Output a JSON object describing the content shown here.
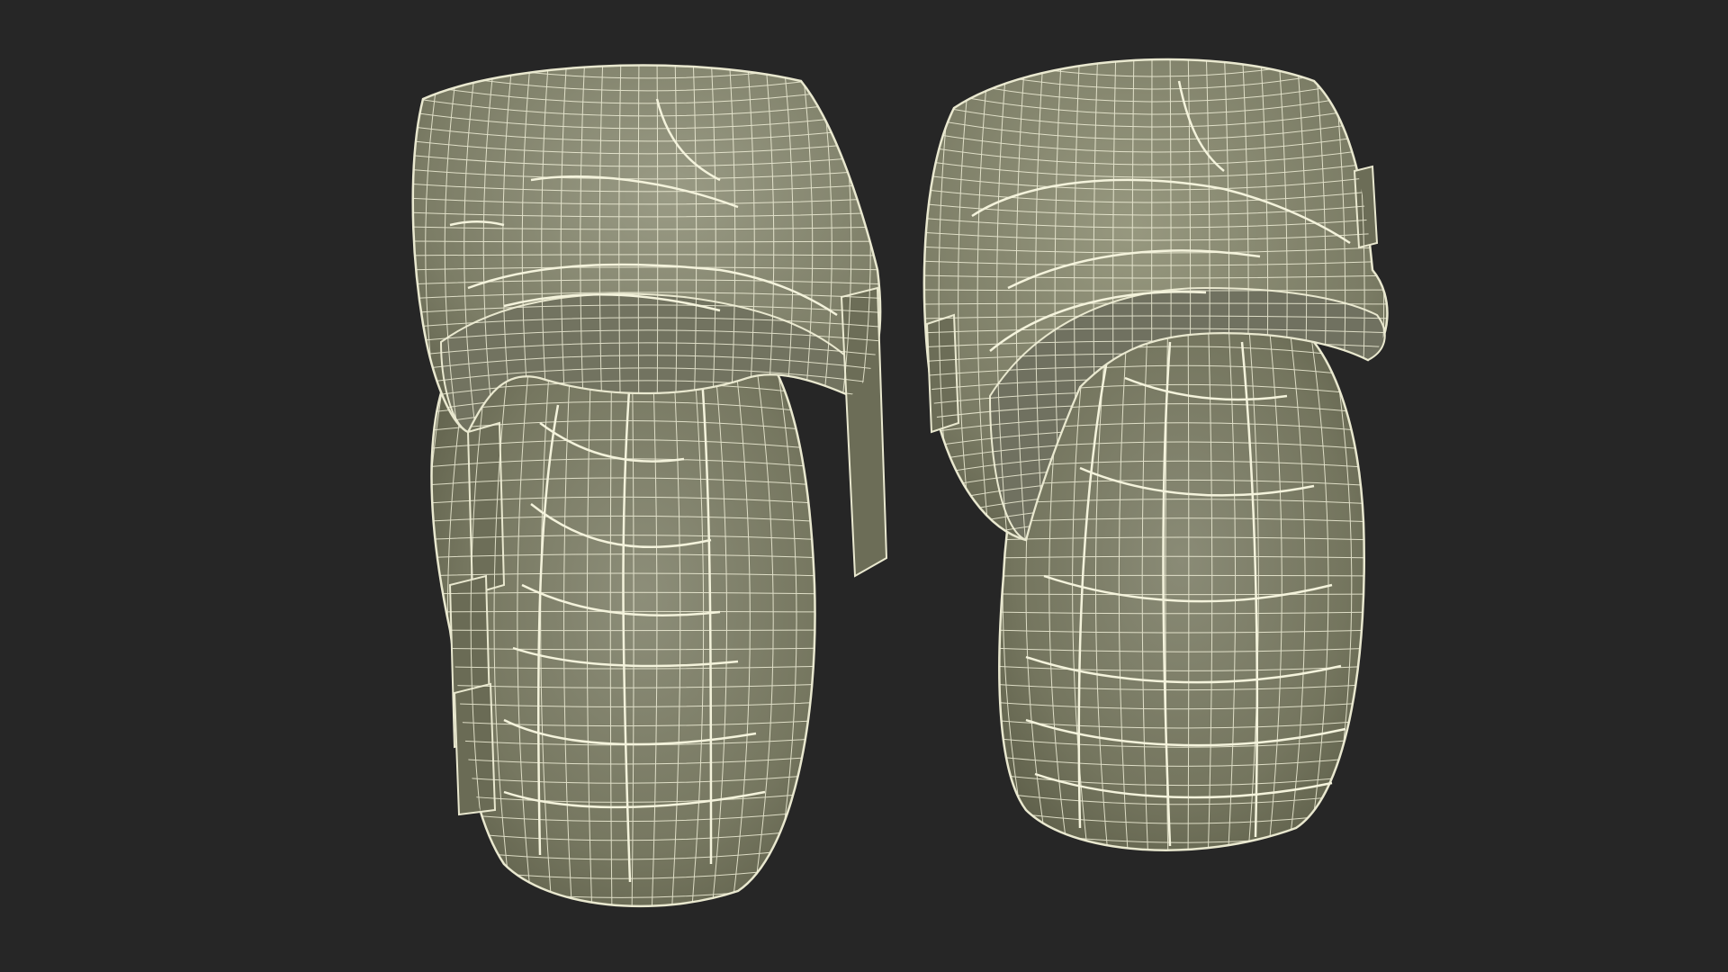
{
  "scene": {
    "subject": "pair-of-knee-pads-wireframe",
    "colors": {
      "background": "#262626",
      "surface_light": "#8a8b76",
      "surface_mid": "#76775f",
      "surface_dark": "#5d5e49",
      "wire": "#f1f0d9"
    },
    "objects": [
      {
        "name": "left-knee-pad"
      },
      {
        "name": "right-knee-pad"
      }
    ]
  }
}
